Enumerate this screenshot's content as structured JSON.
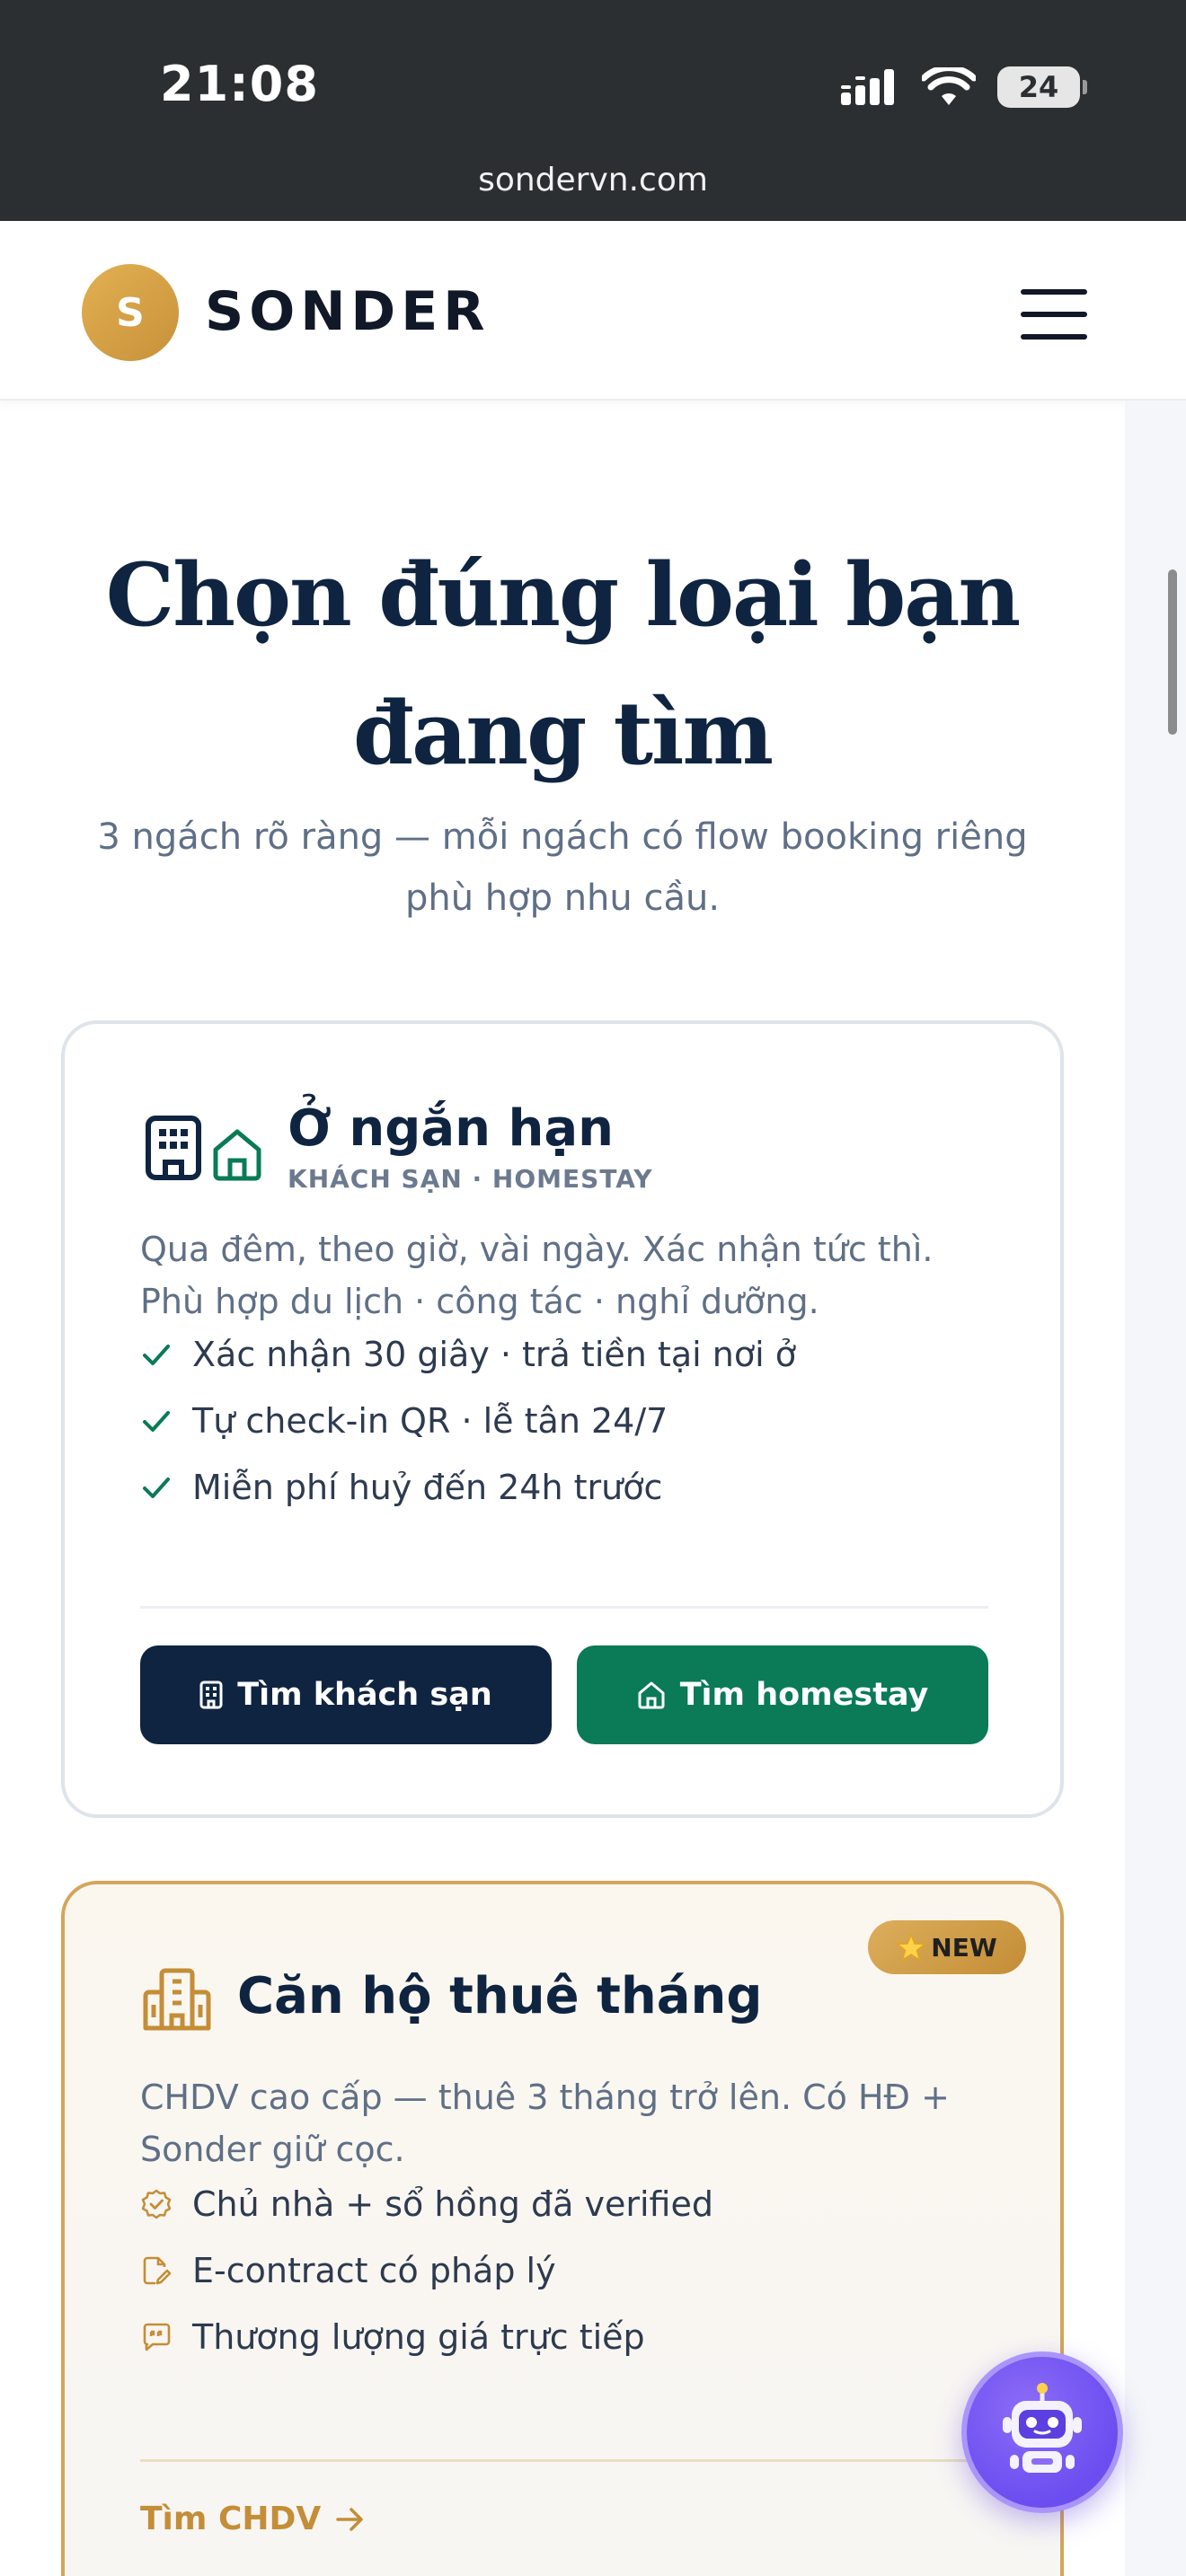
{
  "status_bar": {
    "time": "21:08",
    "battery": "24",
    "url": "sondervn.com"
  },
  "header": {
    "logo_letter": "S",
    "logo_text": "SONDER"
  },
  "hero": {
    "title": "Chọn đúng loại bạn đang tìm",
    "subtitle": "3 ngách rõ ràng — mỗi ngách có flow booking riêng phù hợp nhu cầu."
  },
  "short_stay": {
    "title": "Ở ngắn hạn",
    "kicker": "KHÁCH SẠN · HOMESTAY",
    "description": "Qua đêm, theo giờ, vài ngày. Xác nhận tức thì. Phù hợp du lịch · công tác · nghỉ dưỡng.",
    "features": [
      "Xác nhận 30 giây · trả tiền tại nơi ở",
      "Tự check-in QR · lễ tân 24/7",
      "Miễn phí huỷ đến 24h trước"
    ],
    "buttons": {
      "hotel": "Tìm khách sạn",
      "homestay": "Tìm homestay"
    }
  },
  "monthly": {
    "badge": "NEW",
    "title": "Căn hộ thuê tháng",
    "description": "CHDV cao cấp — thuê 3 tháng trở lên. Có HĐ + Sonder giữ cọc.",
    "features": [
      "Chủ nhà + sổ hồng đã verified",
      "E-contract có pháp lý",
      "Thương lượng giá trực tiếp"
    ],
    "link": "Tìm CHDV"
  },
  "colors": {
    "navy": "#0f2440",
    "green": "#0a7a57",
    "gold": "#c48d37",
    "bot": "#6b4ef0"
  },
  "icons": [
    "signal-icon",
    "wifi-icon",
    "battery-icon",
    "hamburger-menu-icon",
    "building-icon",
    "house-icon",
    "check-icon",
    "badge-check-icon",
    "contract-edit-icon",
    "chat-quote-icon",
    "arrow-right-icon",
    "star-icon",
    "chatbot-icon"
  ]
}
